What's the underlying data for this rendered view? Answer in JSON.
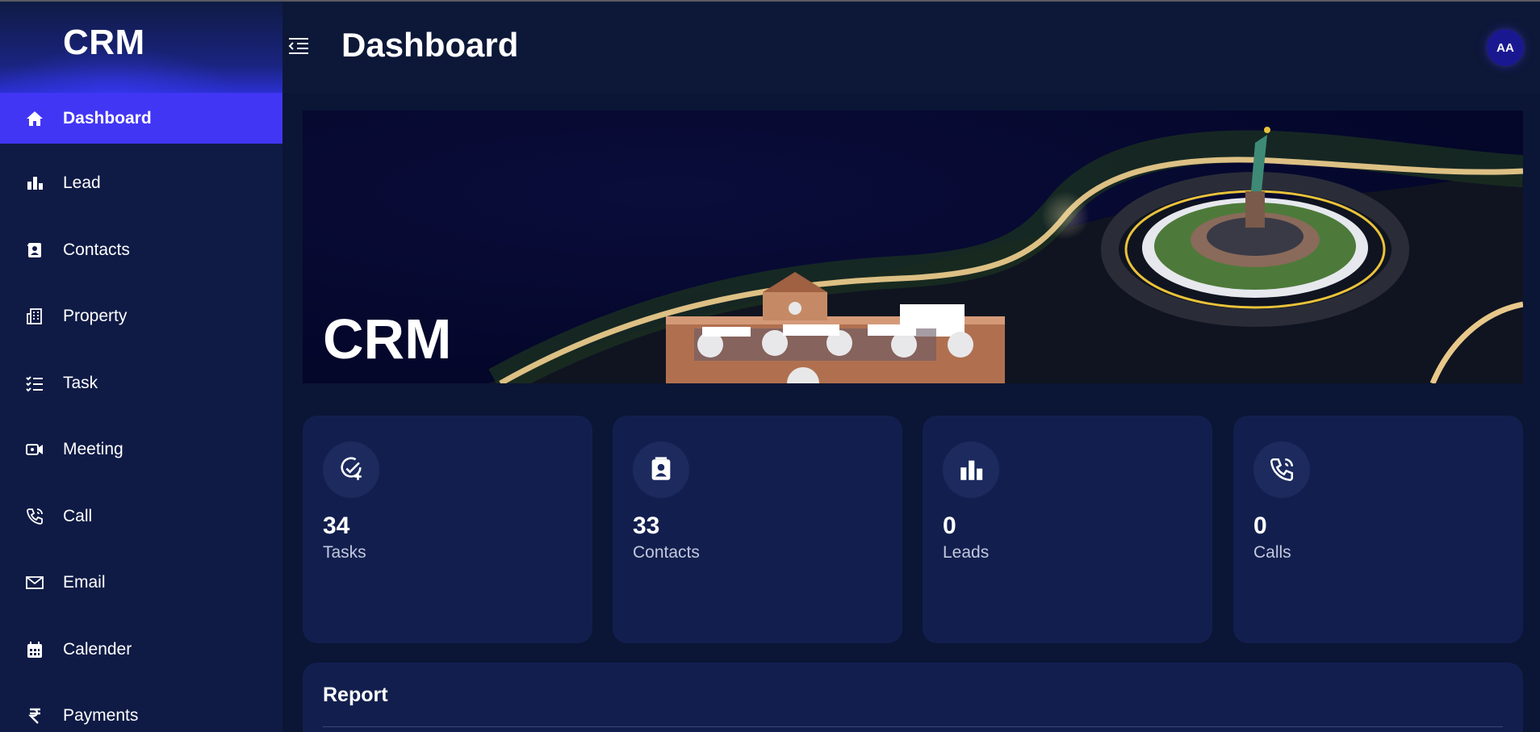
{
  "app": {
    "brand": "CRM"
  },
  "header": {
    "title": "Dashboard",
    "avatar_initials": "AA"
  },
  "sidebar": {
    "items": [
      {
        "label": "Dashboard",
        "icon": "home-icon",
        "active": true
      },
      {
        "label": "Lead",
        "icon": "bar-chart-icon"
      },
      {
        "label": "Contacts",
        "icon": "contact-book-icon"
      },
      {
        "label": "Property",
        "icon": "building-icon"
      },
      {
        "label": "Task",
        "icon": "checklist-icon"
      },
      {
        "label": "Meeting",
        "icon": "video-camera-icon"
      },
      {
        "label": "Call",
        "icon": "phone-icon"
      },
      {
        "label": "Email",
        "icon": "envelope-icon"
      },
      {
        "label": "Calender",
        "icon": "calendar-icon"
      },
      {
        "label": "Payments",
        "icon": "rupee-icon"
      }
    ]
  },
  "hero": {
    "title": "CRM"
  },
  "stats": [
    {
      "value": "34",
      "label": "Tasks",
      "icon": "task-check-icon"
    },
    {
      "value": "33",
      "label": "Contacts",
      "icon": "contact-book-icon"
    },
    {
      "value": "0",
      "label": "Leads",
      "icon": "bar-chart-icon"
    },
    {
      "value": "0",
      "label": "Calls",
      "icon": "phone-icon"
    }
  ],
  "report": {
    "title": "Report"
  },
  "colors": {
    "accent": "#4236f5",
    "background": "#0b1535",
    "card": "#121f4e",
    "sidebar": "#0f1b45"
  }
}
